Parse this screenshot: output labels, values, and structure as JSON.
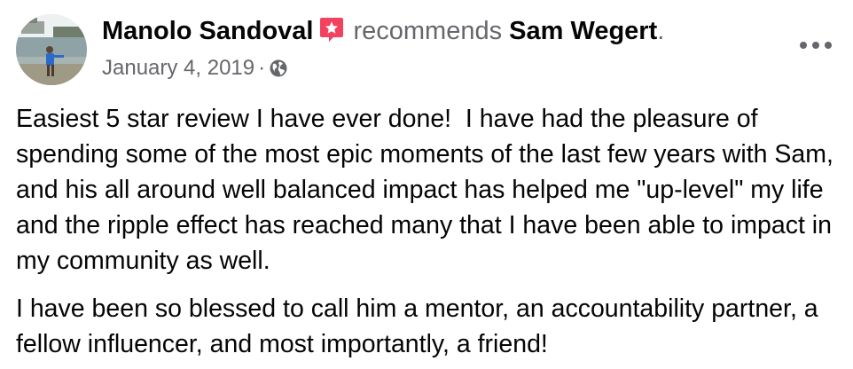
{
  "post": {
    "author": "Manolo Sandoval",
    "verb": "recommends",
    "target": "Sam Wegert",
    "target_suffix": ".",
    "date": "January 4, 2019",
    "separator": "·",
    "privacy_icon": "globe-icon",
    "recommend_icon": "recommend-star-icon",
    "more_icon": "more-options-icon",
    "paragraphs": [
      "Easiest 5 star review I have ever done!  I have had the pleasure of spending some of the most epic moments of the last few years with Sam, and his all around well balanced impact has helped me \"up-level\" my life and the ripple effect has reached many that I have been able to impact in my community as well.",
      "I have been so blessed to call him a mentor, an accountability partner, a fellow influencer, and most importantly, a friend!"
    ]
  },
  "colors": {
    "primary_text": "#050505",
    "secondary_text": "#65676b",
    "recommend_badge": "#f3425f",
    "background": "#ffffff"
  }
}
